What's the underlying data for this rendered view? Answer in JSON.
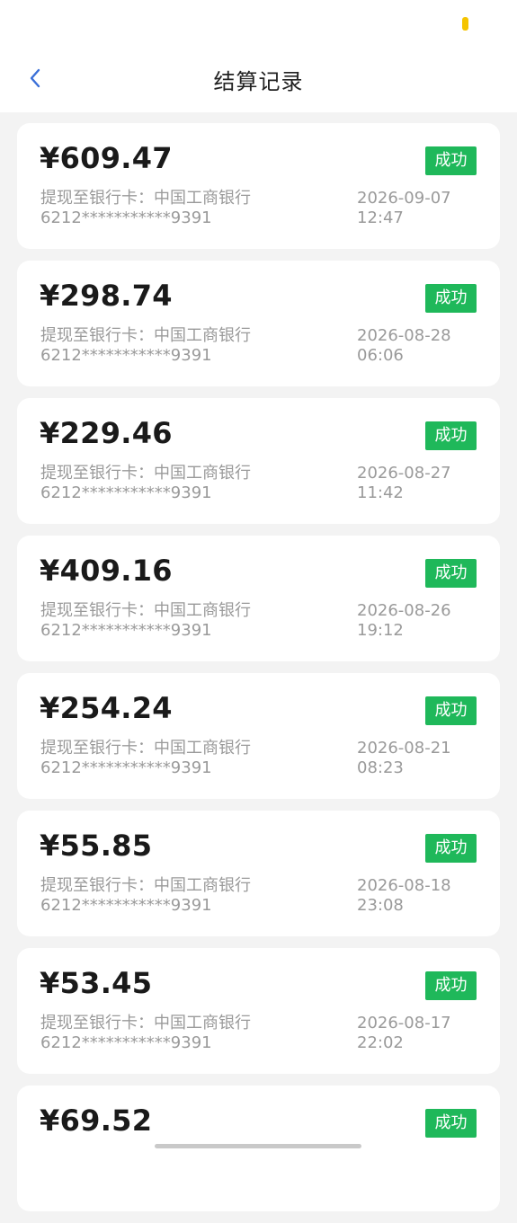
{
  "colors": {
    "success": "#1fb85a",
    "accent": "#3a6fd8",
    "status_indicator": "#f5c400"
  },
  "header": {
    "title": "结算记录",
    "back_icon": "chevron-left-icon"
  },
  "records": [
    {
      "amount": "¥609.47",
      "status": "成功",
      "destination": "提现至银行卡：中国工商银行",
      "card": "6212***********9391",
      "date": "2026-09-07",
      "time": "12:47"
    },
    {
      "amount": "¥298.74",
      "status": "成功",
      "destination": "提现至银行卡：中国工商银行",
      "card": "6212***********9391",
      "date": "2026-08-28",
      "time": "06:06"
    },
    {
      "amount": "¥229.46",
      "status": "成功",
      "destination": "提现至银行卡：中国工商银行",
      "card": "6212***********9391",
      "date": "2026-08-27",
      "time": "11:42"
    },
    {
      "amount": "¥409.16",
      "status": "成功",
      "destination": "提现至银行卡：中国工商银行",
      "card": "6212***********9391",
      "date": "2026-08-26",
      "time": "19:12"
    },
    {
      "amount": "¥254.24",
      "status": "成功",
      "destination": "提现至银行卡：中国工商银行",
      "card": "6212***********9391",
      "date": "2026-08-21",
      "time": "08:23"
    },
    {
      "amount": "¥55.85",
      "status": "成功",
      "destination": "提现至银行卡：中国工商银行",
      "card": "6212***********9391",
      "date": "2026-08-18",
      "time": "23:08"
    },
    {
      "amount": "¥53.45",
      "status": "成功",
      "destination": "提现至银行卡：中国工商银行",
      "card": "6212***********9391",
      "date": "2026-08-17",
      "time": "22:02"
    },
    {
      "amount": "¥69.52",
      "status": "成功",
      "destination": "",
      "card": "",
      "date": "",
      "time": ""
    }
  ]
}
